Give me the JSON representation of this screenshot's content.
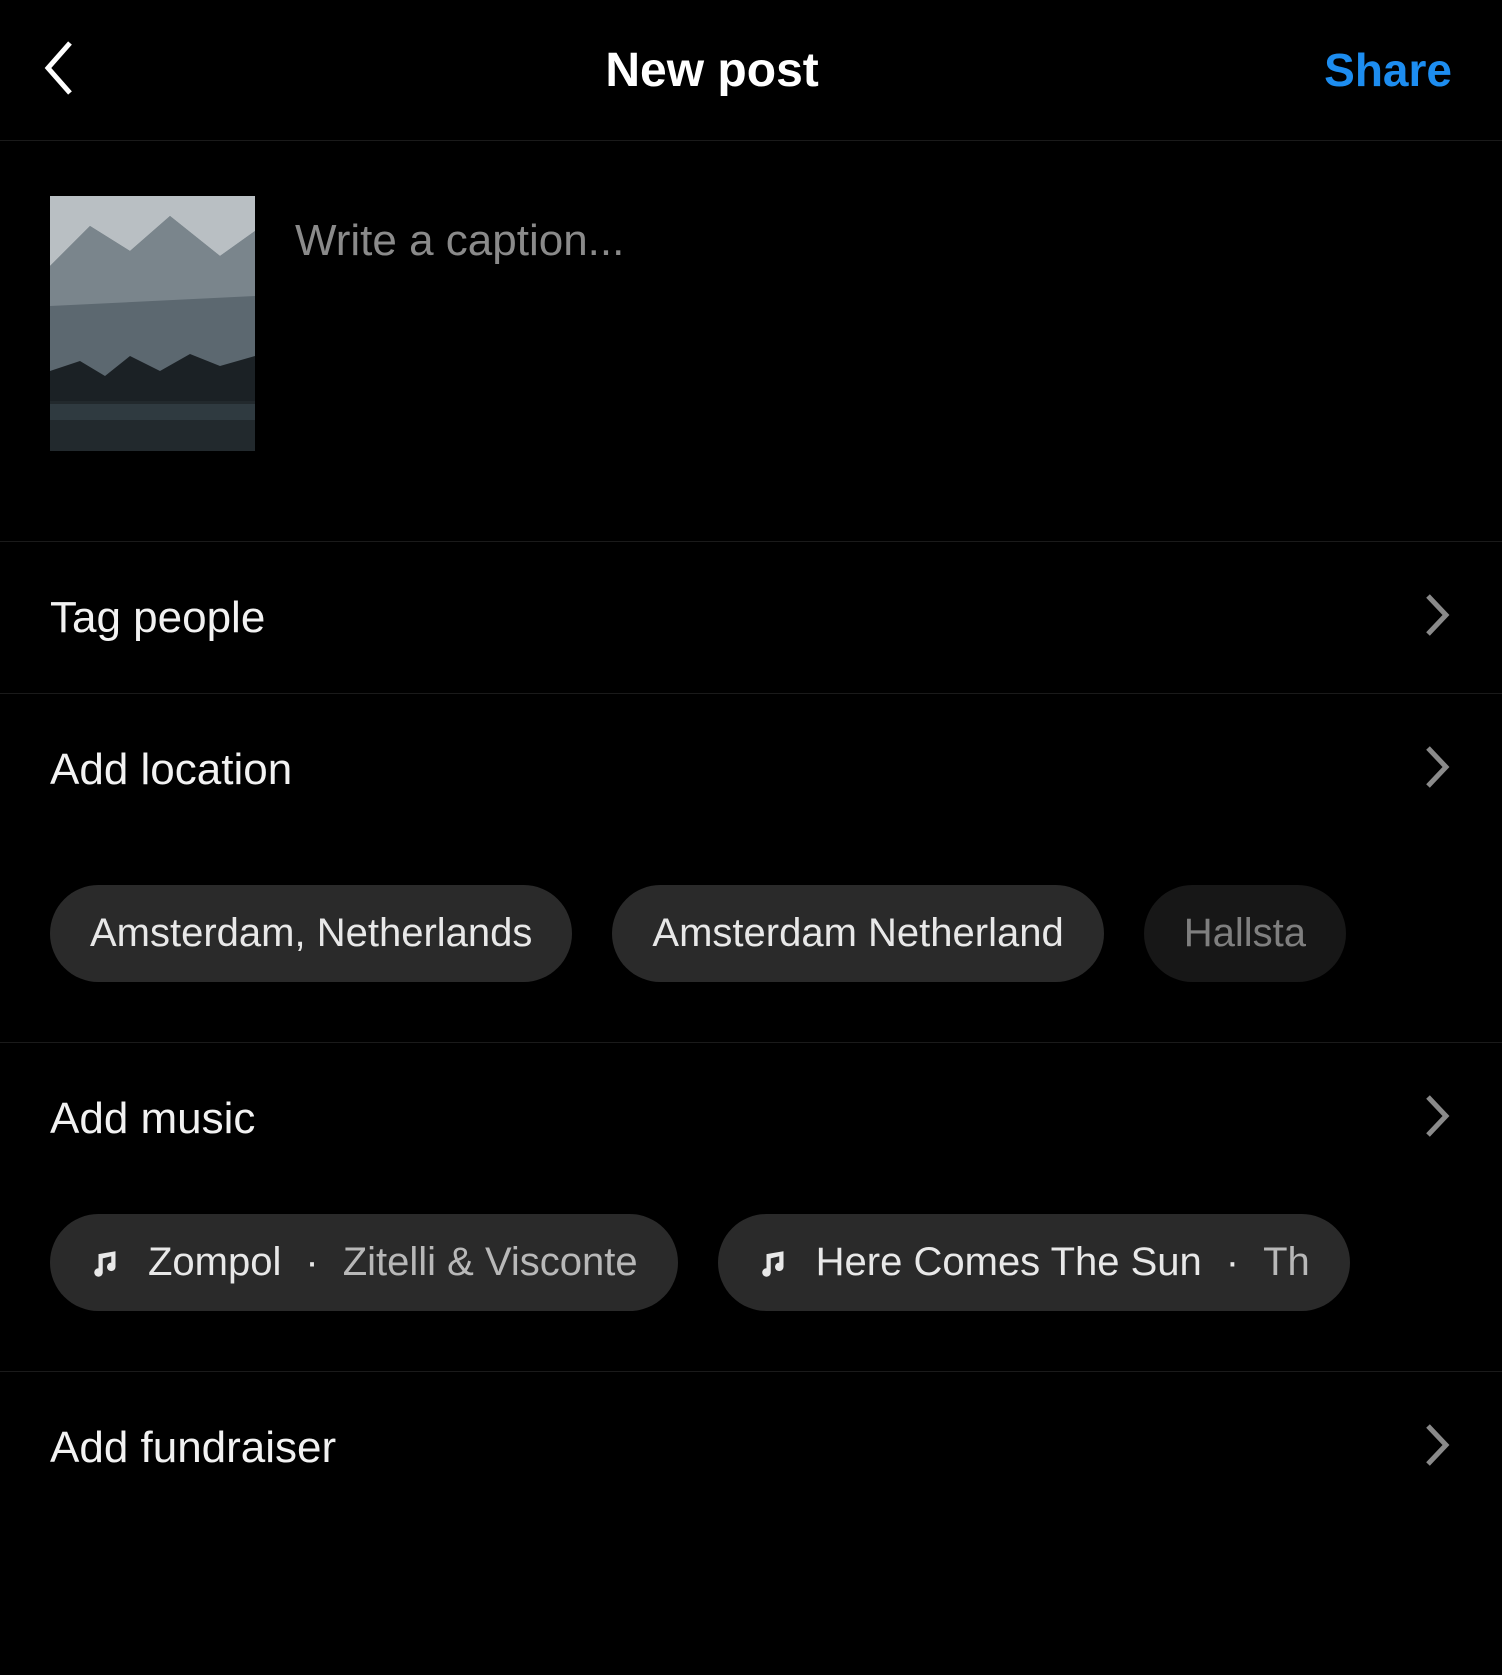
{
  "header": {
    "title": "New post",
    "share_label": "Share"
  },
  "caption": {
    "placeholder": "Write a caption...",
    "value": ""
  },
  "rows": {
    "tag_people": "Tag people",
    "add_location": "Add location",
    "add_music": "Add music",
    "add_fundraiser": "Add fundraiser"
  },
  "location_suggestions": [
    "Amsterdam, Netherlands",
    "Amsterdam Netherland",
    "Hallsta"
  ],
  "music_suggestions": [
    {
      "title": "Zompol",
      "artist": "Zitelli & Visconte"
    },
    {
      "title": "Here Comes The Sun",
      "artist": "Th"
    }
  ],
  "colors": {
    "accent": "#1d8df0",
    "chip_bg": "#2a2a2a",
    "text_secondary": "#8a8a8a"
  }
}
